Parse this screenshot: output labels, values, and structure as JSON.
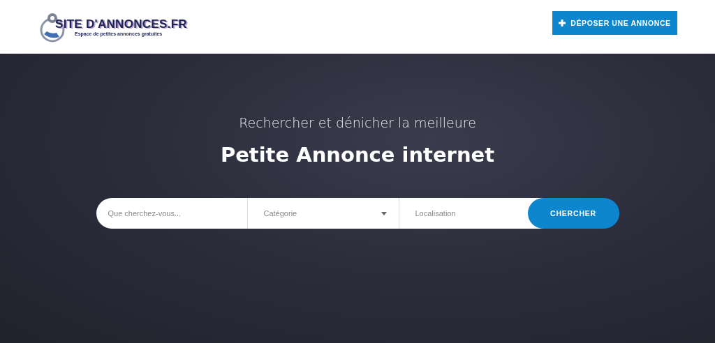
{
  "header": {
    "logo": {
      "name": "SITE D'ANNONCES.FR",
      "tagline": "Espace de petites annonces gratuites"
    },
    "post_button": "DÉPOSER UNE ANNONCE"
  },
  "hero": {
    "subtitle": "Rechercher et dénicher la meilleure",
    "title": "Petite Annonce internet"
  },
  "search": {
    "keyword": {
      "placeholder": "Que cherchez-vous..."
    },
    "category": {
      "placeholder": "Catégorie"
    },
    "location": {
      "placeholder": "Localisation"
    },
    "button": "CHERCHER"
  }
}
